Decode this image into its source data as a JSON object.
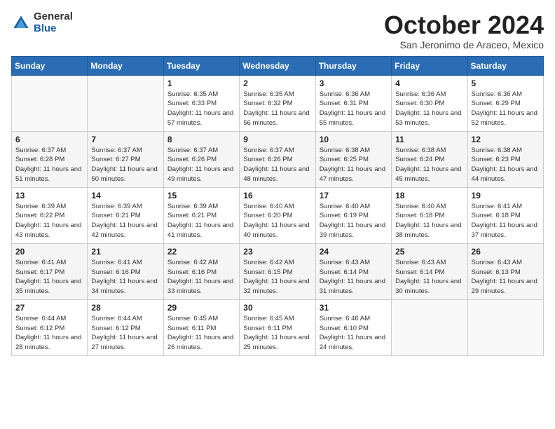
{
  "logo": {
    "general": "General",
    "blue": "Blue"
  },
  "title": "October 2024",
  "subtitle": "San Jeronimo de Araceo, Mexico",
  "weekdays": [
    "Sunday",
    "Monday",
    "Tuesday",
    "Wednesday",
    "Thursday",
    "Friday",
    "Saturday"
  ],
  "weeks": [
    [
      {
        "day": "",
        "info": ""
      },
      {
        "day": "",
        "info": ""
      },
      {
        "day": "1",
        "info": "Sunrise: 6:35 AM\nSunset: 6:33 PM\nDaylight: 11 hours and 57 minutes."
      },
      {
        "day": "2",
        "info": "Sunrise: 6:35 AM\nSunset: 6:32 PM\nDaylight: 11 hours and 56 minutes."
      },
      {
        "day": "3",
        "info": "Sunrise: 6:36 AM\nSunset: 6:31 PM\nDaylight: 11 hours and 55 minutes."
      },
      {
        "day": "4",
        "info": "Sunrise: 6:36 AM\nSunset: 6:30 PM\nDaylight: 11 hours and 53 minutes."
      },
      {
        "day": "5",
        "info": "Sunrise: 6:36 AM\nSunset: 6:29 PM\nDaylight: 11 hours and 52 minutes."
      }
    ],
    [
      {
        "day": "6",
        "info": "Sunrise: 6:37 AM\nSunset: 6:28 PM\nDaylight: 11 hours and 51 minutes."
      },
      {
        "day": "7",
        "info": "Sunrise: 6:37 AM\nSunset: 6:27 PM\nDaylight: 11 hours and 50 minutes."
      },
      {
        "day": "8",
        "info": "Sunrise: 6:37 AM\nSunset: 6:26 PM\nDaylight: 11 hours and 49 minutes."
      },
      {
        "day": "9",
        "info": "Sunrise: 6:37 AM\nSunset: 6:26 PM\nDaylight: 11 hours and 48 minutes."
      },
      {
        "day": "10",
        "info": "Sunrise: 6:38 AM\nSunset: 6:25 PM\nDaylight: 11 hours and 47 minutes."
      },
      {
        "day": "11",
        "info": "Sunrise: 6:38 AM\nSunset: 6:24 PM\nDaylight: 11 hours and 45 minutes."
      },
      {
        "day": "12",
        "info": "Sunrise: 6:38 AM\nSunset: 6:23 PM\nDaylight: 11 hours and 44 minutes."
      }
    ],
    [
      {
        "day": "13",
        "info": "Sunrise: 6:39 AM\nSunset: 6:22 PM\nDaylight: 11 hours and 43 minutes."
      },
      {
        "day": "14",
        "info": "Sunrise: 6:39 AM\nSunset: 6:21 PM\nDaylight: 11 hours and 42 minutes."
      },
      {
        "day": "15",
        "info": "Sunrise: 6:39 AM\nSunset: 6:21 PM\nDaylight: 11 hours and 41 minutes."
      },
      {
        "day": "16",
        "info": "Sunrise: 6:40 AM\nSunset: 6:20 PM\nDaylight: 11 hours and 40 minutes."
      },
      {
        "day": "17",
        "info": "Sunrise: 6:40 AM\nSunset: 6:19 PM\nDaylight: 11 hours and 39 minutes."
      },
      {
        "day": "18",
        "info": "Sunrise: 6:40 AM\nSunset: 6:18 PM\nDaylight: 11 hours and 38 minutes."
      },
      {
        "day": "19",
        "info": "Sunrise: 6:41 AM\nSunset: 6:18 PM\nDaylight: 11 hours and 37 minutes."
      }
    ],
    [
      {
        "day": "20",
        "info": "Sunrise: 6:41 AM\nSunset: 6:17 PM\nDaylight: 11 hours and 35 minutes."
      },
      {
        "day": "21",
        "info": "Sunrise: 6:41 AM\nSunset: 6:16 PM\nDaylight: 11 hours and 34 minutes."
      },
      {
        "day": "22",
        "info": "Sunrise: 6:42 AM\nSunset: 6:16 PM\nDaylight: 11 hours and 33 minutes."
      },
      {
        "day": "23",
        "info": "Sunrise: 6:42 AM\nSunset: 6:15 PM\nDaylight: 11 hours and 32 minutes."
      },
      {
        "day": "24",
        "info": "Sunrise: 6:43 AM\nSunset: 6:14 PM\nDaylight: 11 hours and 31 minutes."
      },
      {
        "day": "25",
        "info": "Sunrise: 6:43 AM\nSunset: 6:14 PM\nDaylight: 11 hours and 30 minutes."
      },
      {
        "day": "26",
        "info": "Sunrise: 6:43 AM\nSunset: 6:13 PM\nDaylight: 11 hours and 29 minutes."
      }
    ],
    [
      {
        "day": "27",
        "info": "Sunrise: 6:44 AM\nSunset: 6:12 PM\nDaylight: 11 hours and 28 minutes."
      },
      {
        "day": "28",
        "info": "Sunrise: 6:44 AM\nSunset: 6:12 PM\nDaylight: 11 hours and 27 minutes."
      },
      {
        "day": "29",
        "info": "Sunrise: 6:45 AM\nSunset: 6:11 PM\nDaylight: 11 hours and 26 minutes."
      },
      {
        "day": "30",
        "info": "Sunrise: 6:45 AM\nSunset: 6:11 PM\nDaylight: 11 hours and 25 minutes."
      },
      {
        "day": "31",
        "info": "Sunrise: 6:46 AM\nSunset: 6:10 PM\nDaylight: 11 hours and 24 minutes."
      },
      {
        "day": "",
        "info": ""
      },
      {
        "day": "",
        "info": ""
      }
    ]
  ]
}
